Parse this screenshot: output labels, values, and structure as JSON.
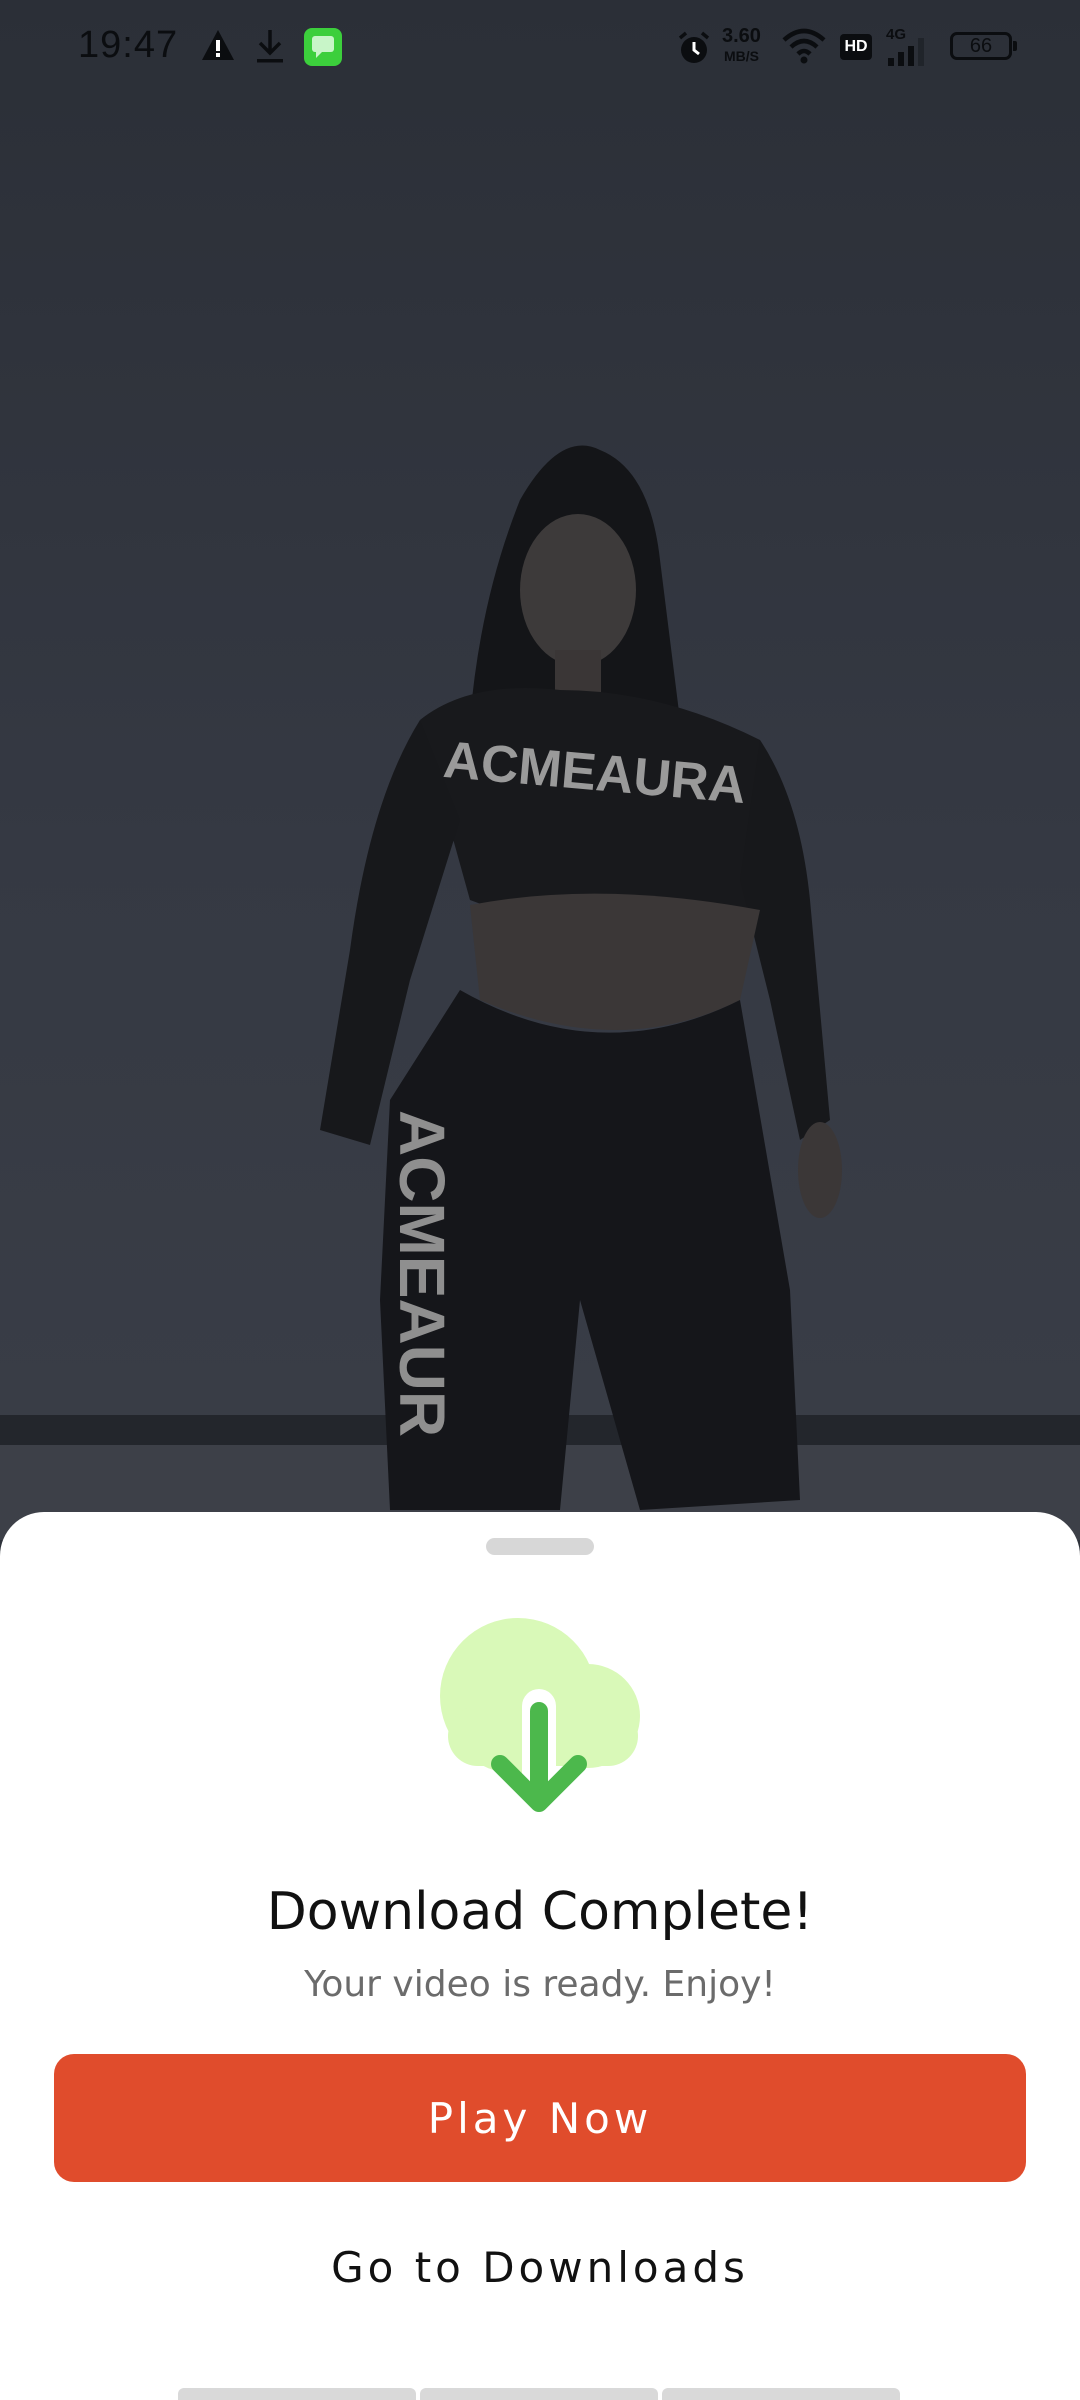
{
  "status_bar": {
    "time": "19:47",
    "net_speed_value": "3.60",
    "net_speed_unit": "MB/S",
    "hd_label": "HD",
    "signal_label": "4G",
    "battery": "66",
    "icons": [
      "warning-icon",
      "download-icon",
      "messages-app-icon",
      "alarm-icon",
      "wifi-icon",
      "hd-icon",
      "signal-icon",
      "battery-icon"
    ]
  },
  "background": {
    "shirt_text": "ACMEAURA",
    "pants_text": "ACMEAUR"
  },
  "sheet": {
    "title": "Download Complete!",
    "subtitle": "Your video is ready. Enjoy!",
    "primary_button": "Play Now",
    "secondary_button": "Go to Downloads",
    "icon": "cloud-download-icon"
  },
  "colors": {
    "accent": "#e04c2c",
    "cloud": "#d9f9b8",
    "arrow": "#4cb84c"
  }
}
